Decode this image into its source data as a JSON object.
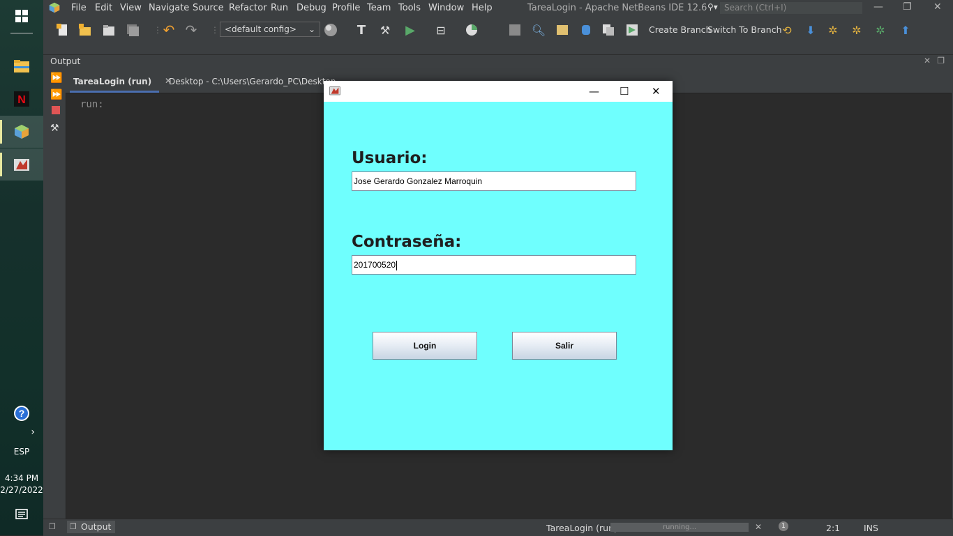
{
  "taskbar": {
    "lang": "ESP",
    "time": "4:34 PM",
    "date": "2/27/2022"
  },
  "ide": {
    "title": "TareaLogin - Apache NetBeans IDE 12.6",
    "menu": [
      "File",
      "Edit",
      "View",
      "Navigate",
      "Source",
      "Refactor",
      "Run",
      "Debug",
      "Profile",
      "Team",
      "Tools",
      "Window",
      "Help"
    ],
    "search_placeholder": "Search (Ctrl+I)",
    "config": "<default config>",
    "toolbar_labels": {
      "create_branch": "Create Branch",
      "switch_branch": "Switch To Branch"
    },
    "output_title": "Output",
    "tabs": [
      {
        "label": "TareaLogin (run)",
        "active": true
      },
      {
        "label": "Desktop - C:\\Users\\Gerardo_PC\\Desktop",
        "active": false
      }
    ],
    "console_text": "run:",
    "status": {
      "output_btn": "Output",
      "task": "TareaLogin (run)",
      "progress_text": "running...",
      "notifications": "1",
      "position": "2:1",
      "mode": "INS"
    }
  },
  "login": {
    "usuario_label": "Usuario:",
    "usuario_value": "Jose Gerardo Gonzalez Marroquin",
    "password_label": "Contraseña:",
    "password_value": "201700520",
    "login_button": "Login",
    "exit_button": "Salir",
    "background": "#6ffffe"
  }
}
